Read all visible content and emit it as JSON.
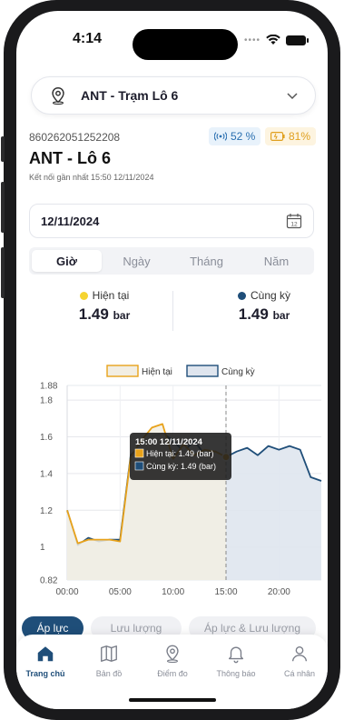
{
  "status": {
    "time": "4:14"
  },
  "station_selector": {
    "label": "ANT - Trạm Lô 6"
  },
  "device": {
    "id": "860262051252208",
    "signal": "52 %",
    "battery": "81%",
    "name": "ANT - Lô 6",
    "last_connection": "Kết nối gần nhất 15:50 12/11/2024"
  },
  "date_picker": {
    "value": "12/11/2024"
  },
  "period_tabs": [
    {
      "label": "Giờ",
      "active": true
    },
    {
      "label": "Ngày",
      "active": false
    },
    {
      "label": "Tháng",
      "active": false
    },
    {
      "label": "Năm",
      "active": false
    }
  ],
  "summary": {
    "current": {
      "label": "Hiện tại",
      "value": "1.49",
      "unit": "bar",
      "color": "#f5d431"
    },
    "previous": {
      "label": "Cùng kỳ",
      "value": "1.49",
      "unit": "bar",
      "color": "#1f4e79"
    }
  },
  "chart_data": {
    "type": "area",
    "legend": [
      "Hiện tại",
      "Cùng kỳ"
    ],
    "legend_position": "top",
    "ylim": [
      0.82,
      1.88
    ],
    "y_ticks": [
      "1.88",
      "1.8",
      "1.6",
      "1.4",
      "1.2",
      "1",
      "0.82"
    ],
    "x_ticks": [
      "00:00",
      "05:00",
      "10:00",
      "15:00",
      "20:00"
    ],
    "xlim": [
      0,
      24
    ],
    "grid": true,
    "cursor_x": 15,
    "series": [
      {
        "name": "Hiện tại",
        "color": "#e8a21a",
        "fill": "#f2eee3",
        "x": [
          0,
          1,
          2,
          3,
          4,
          5,
          6,
          7,
          8,
          9,
          10,
          11,
          12,
          13,
          14,
          15
        ],
        "values": [
          1.2,
          1.02,
          1.04,
          1.04,
          1.04,
          1.03,
          1.49,
          1.58,
          1.65,
          1.67,
          1.48,
          1.56,
          1.5,
          1.53,
          1.52,
          1.49
        ]
      },
      {
        "name": "Cùng kỳ",
        "color": "#1f4e79",
        "fill": "#dfe5ee",
        "x": [
          0,
          1,
          2,
          3,
          4,
          5,
          6,
          7,
          8,
          9,
          10,
          11,
          12,
          13,
          14,
          15,
          16,
          17,
          18,
          19,
          20,
          21,
          22,
          23,
          24
        ],
        "values": [
          1.2,
          1.01,
          1.05,
          1.03,
          1.04,
          1.04,
          1.5,
          1.56,
          1.6,
          1.62,
          1.58,
          1.52,
          1.58,
          1.5,
          1.52,
          1.49,
          1.52,
          1.54,
          1.5,
          1.55,
          1.53,
          1.55,
          1.53,
          1.38,
          1.36
        ]
      }
    ],
    "tooltip": {
      "title": "15:00 12/11/2024",
      "rows": [
        {
          "label": "Hiện tại: 1.49 (bar)",
          "color": "#e8a21a"
        },
        {
          "label": "Cùng kỳ: 1.49 (bar)",
          "color": "#1f4e79"
        }
      ]
    }
  },
  "segments": [
    {
      "label": "Áp lực",
      "active": true
    },
    {
      "label": "Lưu lượng",
      "active": false
    },
    {
      "label": "Áp lực & Lưu lượng",
      "active": false
    }
  ],
  "bottom_nav": [
    {
      "label": "Trang chủ",
      "icon": "home-icon",
      "active": true
    },
    {
      "label": "Bản đồ",
      "icon": "map-icon",
      "active": false
    },
    {
      "label": "Điểm đo",
      "icon": "pin-icon",
      "active": false
    },
    {
      "label": "Thông báo",
      "icon": "bell-icon",
      "active": false
    },
    {
      "label": "Cá nhân",
      "icon": "user-icon",
      "active": false
    }
  ],
  "colors": {
    "accent": "#1f4e79",
    "current": "#e8a21a"
  }
}
